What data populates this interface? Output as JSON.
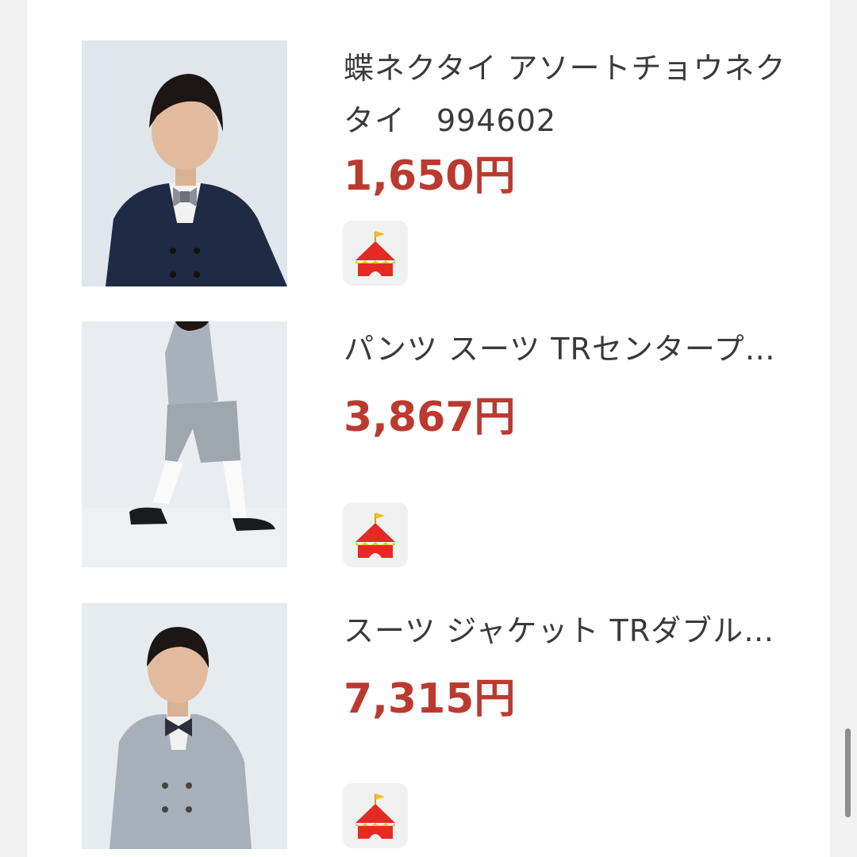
{
  "items": [
    {
      "title": "蝶ネクタイ アソートチョウネクタイ　994602",
      "price": "1,650円",
      "image": "boy-navy-suit-gray-bowtie",
      "badge_icon": "circus-tent-icon"
    },
    {
      "title": "パンツ スーツ TRセンタープ…",
      "price": "3,867円",
      "image": "kid-walking-gray-shorts",
      "badge_icon": "circus-tent-icon"
    },
    {
      "title": "スーツ ジャケット TRダブル…",
      "price": "7,315円",
      "image": "boy-gray-double-jacket",
      "badge_icon": "circus-tent-icon"
    }
  ],
  "colors": {
    "price": "#bb3a30",
    "background": "#f1f1f2",
    "panel": "#ffffff"
  }
}
